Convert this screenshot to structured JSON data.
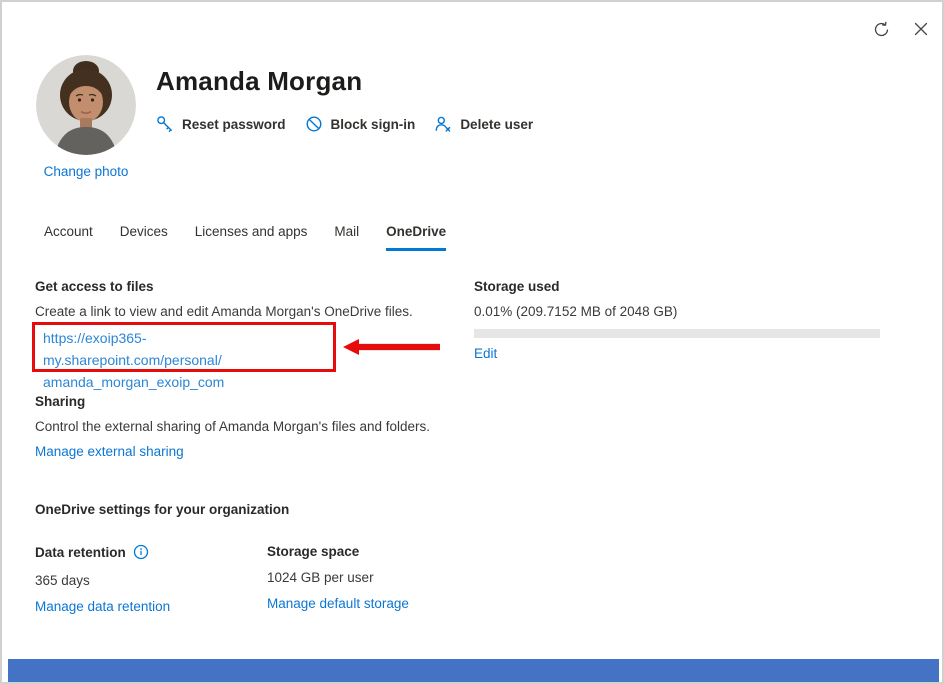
{
  "window": {
    "refresh_icon": "refresh-icon",
    "close_icon": "close-icon"
  },
  "header": {
    "title": "Amanda Morgan",
    "change_photo_label": "Change photo",
    "actions": [
      {
        "label": "Reset password",
        "icon": "key-icon"
      },
      {
        "label": "Block sign-in",
        "icon": "block-icon"
      },
      {
        "label": "Delete user",
        "icon": "person-delete-icon"
      }
    ]
  },
  "tabs": [
    {
      "label": "Account",
      "active": false
    },
    {
      "label": "Devices",
      "active": false
    },
    {
      "label": "Licenses and apps",
      "active": false
    },
    {
      "label": "Mail",
      "active": false
    },
    {
      "label": "OneDrive",
      "active": true
    }
  ],
  "get_access": {
    "heading": "Get access to files",
    "description": "Create a link to view and edit Amanda Morgan's OneDrive files.",
    "url_line1": "https://exoip365-my.sharepoint.com/personal/",
    "url_line2": "amanda_morgan_exoip_com"
  },
  "storage_used": {
    "heading": "Storage used",
    "usage_text": "0.01% (209.7152 MB of 2048 GB)",
    "percent_used": 0.01,
    "edit_label": "Edit"
  },
  "sharing": {
    "heading": "Sharing",
    "description": "Control the external sharing of Amanda Morgan's files and folders.",
    "manage_label": "Manage external sharing"
  },
  "org_settings": {
    "heading": "OneDrive settings for your organization",
    "data_retention": {
      "label": "Data retention",
      "info_icon": "info-icon",
      "value": "365 days",
      "manage_label": "Manage data retention"
    },
    "storage_space": {
      "label": "Storage space",
      "value": "1024 GB per user",
      "manage_label": "Manage default storage"
    }
  },
  "annotations": {
    "highlight_box": "red-highlight-box",
    "arrow": "red-arrow-left-icon"
  },
  "colors": {
    "accent_blue": "#0078d4",
    "link_blue": "#0b76d4",
    "url_blue": "#2b86d6",
    "annotation_red": "#e60c0c",
    "bottom_bar_blue": "#4472c4",
    "progress_track": "#e6e6e6",
    "text_dark": "#323130",
    "icon_gray": "#494745"
  }
}
